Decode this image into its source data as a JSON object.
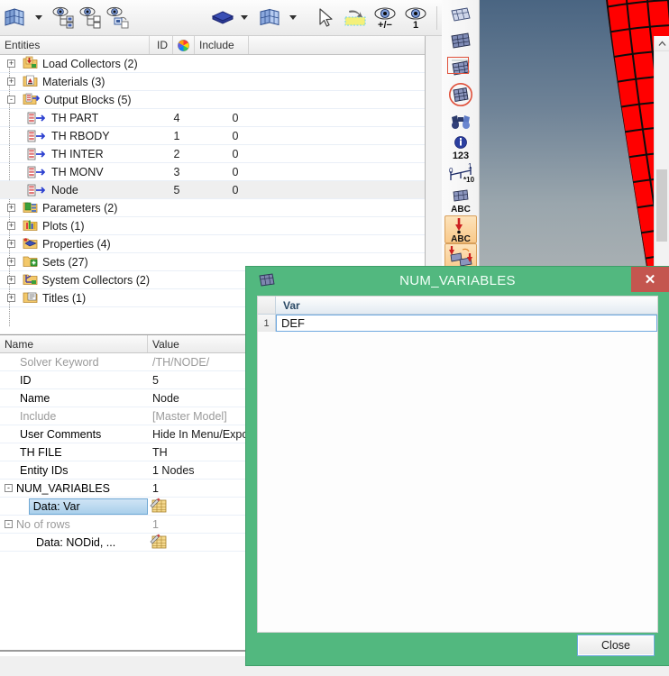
{
  "toolbar": {
    "items": [
      {
        "name": "mesh-panels-icon",
        "label": "Mesh Panels"
      },
      {
        "name": "chevron-down-icon",
        "label": "More"
      },
      {
        "name": "display-all-icon",
        "label": "Display All"
      },
      {
        "name": "display-none-icon",
        "label": "Display None"
      },
      {
        "name": "display-reverse-icon",
        "label": "Display Reverse"
      },
      {
        "name": "shaded-elements-icon",
        "label": "Shaded Elements"
      },
      {
        "name": "chevron-down-icon-2",
        "label": "More"
      },
      {
        "name": "visualization-mode-icon",
        "label": "Visualization Mode"
      },
      {
        "name": "chevron-down-icon-3",
        "label": "More"
      },
      {
        "name": "pointer-cursor-icon",
        "label": "Select"
      },
      {
        "name": "highlight-entity-icon",
        "label": "Highlight"
      },
      {
        "name": "show-hide-plusminus-icon",
        "label": "Show / Hide"
      },
      {
        "name": "isolate-one-icon",
        "label": "Isolate"
      }
    ]
  },
  "vtoolbar": {
    "items": [
      {
        "name": "mesh-shrink-icon",
        "label": "Shrink Elements"
      },
      {
        "name": "mesh-solid-icon",
        "label": "Solid Mesh"
      },
      {
        "name": "mesh-boundary-icon",
        "label": "Mesh Boundary",
        "highlight": false
      },
      {
        "name": "mesh-circle-icon",
        "label": "Mesh Circle"
      },
      {
        "name": "binoculars-icon",
        "label": "Find"
      },
      {
        "name": "info-123-icon",
        "label": "Numbers"
      },
      {
        "name": "measure-scale-icon",
        "label": "Measure"
      },
      {
        "name": "mesh-abc-icon",
        "label": "Element Labels"
      },
      {
        "name": "node-abc-icon",
        "label": "Node Labels",
        "highlight": true
      },
      {
        "name": "element-attach-icon",
        "label": "Attach",
        "highlight": true
      }
    ]
  },
  "tree": {
    "columns": {
      "entities": "Entities",
      "id": "ID",
      "color": "color-wheel-icon",
      "include": "Include"
    },
    "rows": [
      {
        "level": 0,
        "icon": "folder-load-collectors-icon",
        "expander": "+",
        "label": "Load Collectors (2)",
        "id": "",
        "include": "",
        "selected": false
      },
      {
        "level": 0,
        "icon": "folder-materials-icon",
        "expander": "+",
        "label": "Materials (3)",
        "id": "",
        "include": "",
        "selected": false
      },
      {
        "level": 0,
        "icon": "folder-output-blocks-icon",
        "expander": "-",
        "label": "Output Blocks (5)",
        "id": "",
        "include": "",
        "selected": false
      },
      {
        "level": 1,
        "icon": "output-block-icon",
        "expander": "",
        "label": "TH PART",
        "id": "4",
        "include": "0",
        "selected": false
      },
      {
        "level": 1,
        "icon": "output-block-icon",
        "expander": "",
        "label": "TH RBODY",
        "id": "1",
        "include": "0",
        "selected": false
      },
      {
        "level": 1,
        "icon": "output-block-icon",
        "expander": "",
        "label": "TH INTER",
        "id": "2",
        "include": "0",
        "selected": false
      },
      {
        "level": 1,
        "icon": "output-block-icon",
        "expander": "",
        "label": "TH MONV",
        "id": "3",
        "include": "0",
        "selected": false
      },
      {
        "level": 1,
        "icon": "output-block-icon",
        "expander": "",
        "label": "Node",
        "id": "5",
        "include": "0",
        "selected": true
      },
      {
        "level": 0,
        "icon": "folder-parameters-icon",
        "expander": "+",
        "label": "Parameters (2)",
        "id": "",
        "include": "",
        "selected": false
      },
      {
        "level": 0,
        "icon": "folder-plots-icon",
        "expander": "+",
        "label": "Plots (1)",
        "id": "",
        "include": "",
        "selected": false
      },
      {
        "level": 0,
        "icon": "folder-properties-icon",
        "expander": "+",
        "label": "Properties (4)",
        "id": "",
        "include": "",
        "selected": false
      },
      {
        "level": 0,
        "icon": "folder-sets-icon",
        "expander": "+",
        "label": "Sets (27)",
        "id": "",
        "include": "",
        "selected": false
      },
      {
        "level": 0,
        "icon": "folder-system-collectors-icon",
        "expander": "+",
        "label": "System Collectors (2)",
        "id": "",
        "include": "",
        "selected": false
      },
      {
        "level": 0,
        "icon": "folder-titles-icon",
        "expander": "+",
        "label": "Titles (1)",
        "id": "",
        "include": "",
        "selected": false
      }
    ]
  },
  "properties": {
    "columns": {
      "name": "Name",
      "value": "Value"
    },
    "rows": [
      {
        "indent": "lg",
        "expander": "",
        "name": "Solver Keyword",
        "value": "/TH/NODE/",
        "dim": true,
        "editor": false,
        "selected": false
      },
      {
        "indent": "lg",
        "expander": "",
        "name": "ID",
        "value": "5",
        "dim": false,
        "editor": false,
        "selected": false
      },
      {
        "indent": "lg",
        "expander": "",
        "name": "Name",
        "value": "Node",
        "dim": false,
        "editor": false,
        "selected": false
      },
      {
        "indent": "lg",
        "expander": "",
        "name": "Include",
        "value": "[Master Model]",
        "dim": true,
        "editor": false,
        "selected": false
      },
      {
        "indent": "lg",
        "expander": "",
        "name": "User Comments",
        "value": "Hide In Menu/Expo",
        "dim": false,
        "editor": false,
        "selected": false
      },
      {
        "indent": "lg",
        "expander": "",
        "name": "TH FILE",
        "value": "TH",
        "dim": false,
        "editor": false,
        "selected": false
      },
      {
        "indent": "lg",
        "expander": "",
        "name": "Entity IDs",
        "value": "1 Nodes",
        "dim": false,
        "editor": false,
        "selected": false
      },
      {
        "indent": "none",
        "expander": "-",
        "name": "NUM_VARIABLES",
        "value": "1",
        "dim": false,
        "editor": false,
        "selected": false
      },
      {
        "indent": "xl",
        "expander": "",
        "name": "Data: Var",
        "value": "",
        "dim": false,
        "editor": true,
        "selected": true
      },
      {
        "indent": "none",
        "expander": "-",
        "name": "No of rows",
        "value": "1",
        "dim": true,
        "editor": false,
        "selected": false
      },
      {
        "indent": "xl",
        "expander": "",
        "name": "Data: NODid, ...",
        "value": "",
        "dim": false,
        "editor": true,
        "selected": false
      }
    ]
  },
  "dialog": {
    "title": "NUM_VARIABLES",
    "window_icon": "grid-table-icon",
    "close_icon": "✕",
    "grid": {
      "row_number_header": "",
      "columns": [
        "Var"
      ],
      "rows": [
        {
          "num": "1",
          "var": "DEF"
        }
      ]
    },
    "close_button": "Close"
  },
  "colors": {
    "dialog_frame": "#52b87f",
    "dialog_close_button": "#c4564f",
    "mesh": "#ff0000",
    "selection": "#a9cfeb",
    "focus_border": "#6fa8e0"
  }
}
